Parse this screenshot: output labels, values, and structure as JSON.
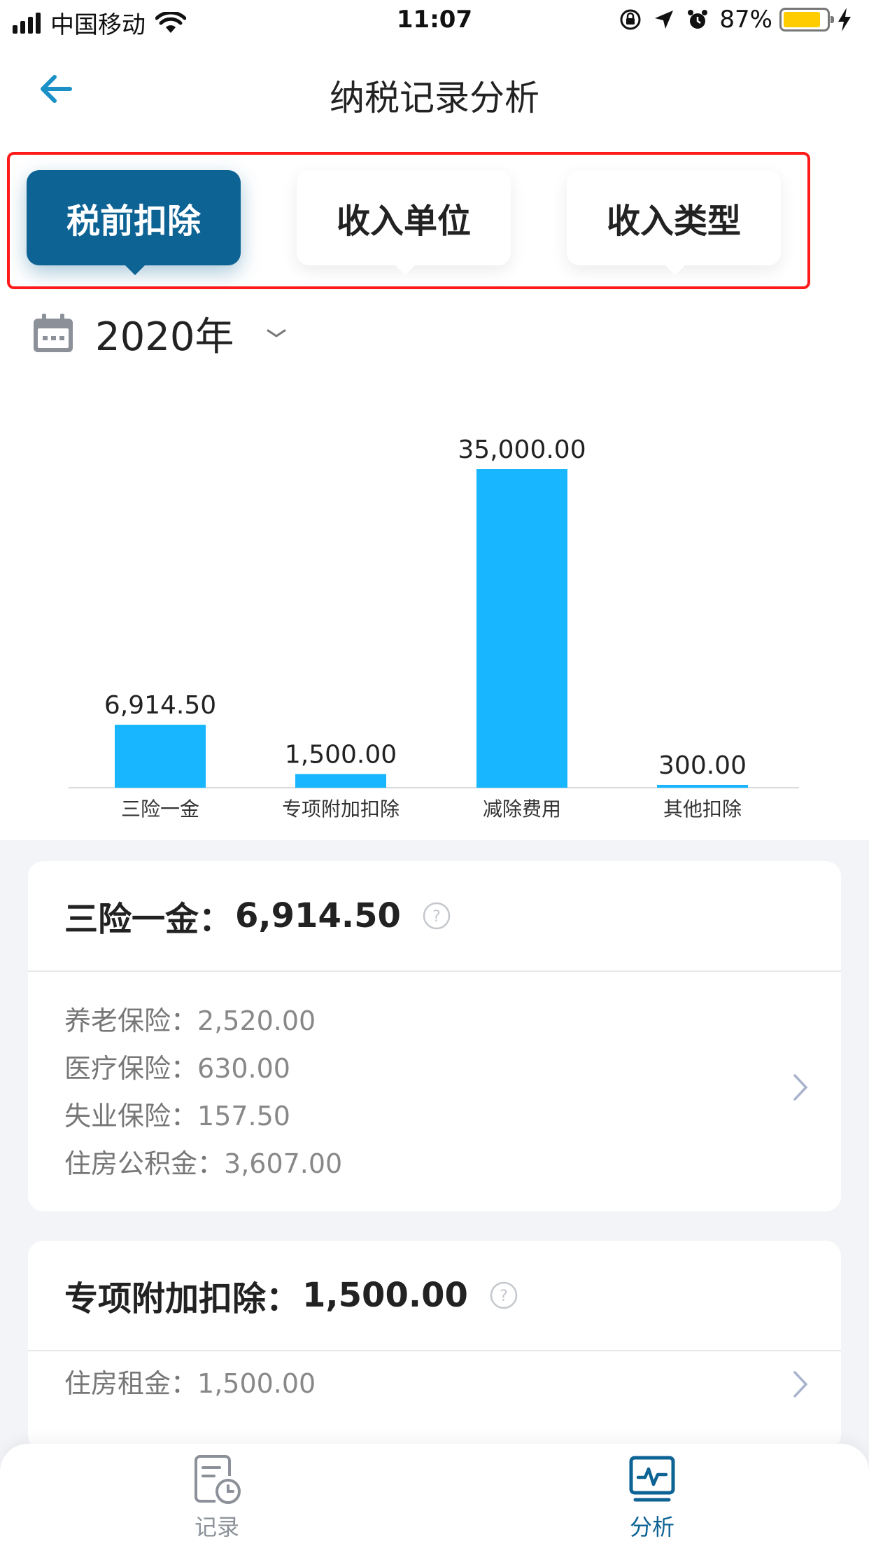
{
  "status_bar": {
    "carrier": "中国移动",
    "time": "11:07",
    "battery": "87%"
  },
  "nav": {
    "title": "纳税记录分析"
  },
  "tabs": [
    {
      "label": "税前扣除",
      "active": true
    },
    {
      "label": "收入单位",
      "active": false
    },
    {
      "label": "收入类型",
      "active": false
    }
  ],
  "year": "2020年",
  "colors": {
    "accent": "#0d6394",
    "bar": "#18b6ff",
    "highlight_frame": "#ff1a1a",
    "tab_active_icon": "#0d6394"
  },
  "chart_data": {
    "type": "bar",
    "categories": [
      "三险一金",
      "专项附加扣除",
      "减除费用",
      "其他扣除"
    ],
    "values": [
      6914.5,
      1500.0,
      35000.0,
      300.0
    ],
    "value_labels": [
      "6,914.50",
      "1,500.00",
      "35,000.00",
      "300.00"
    ],
    "ylim": [
      0,
      35000
    ],
    "grid": false
  },
  "cards": [
    {
      "title": "三险一金：",
      "amount": "6,914.50",
      "lines": [
        {
          "label": "养老保险：",
          "value": "2,520.00"
        },
        {
          "label": "医疗保险：",
          "value": "630.00"
        },
        {
          "label": "失业保险：",
          "value": "157.50"
        },
        {
          "label": "住房公积金：",
          "value": "3,607.00"
        }
      ]
    },
    {
      "title": "专项附加扣除：",
      "amount": "1,500.00",
      "lines": [
        {
          "label": "住房租金：",
          "value": "1,500.00"
        }
      ]
    }
  ],
  "tabbar": {
    "items": [
      {
        "label": "记录",
        "icon": "record-icon",
        "active": false
      },
      {
        "label": "分析",
        "icon": "analysis-icon",
        "active": true
      }
    ]
  }
}
